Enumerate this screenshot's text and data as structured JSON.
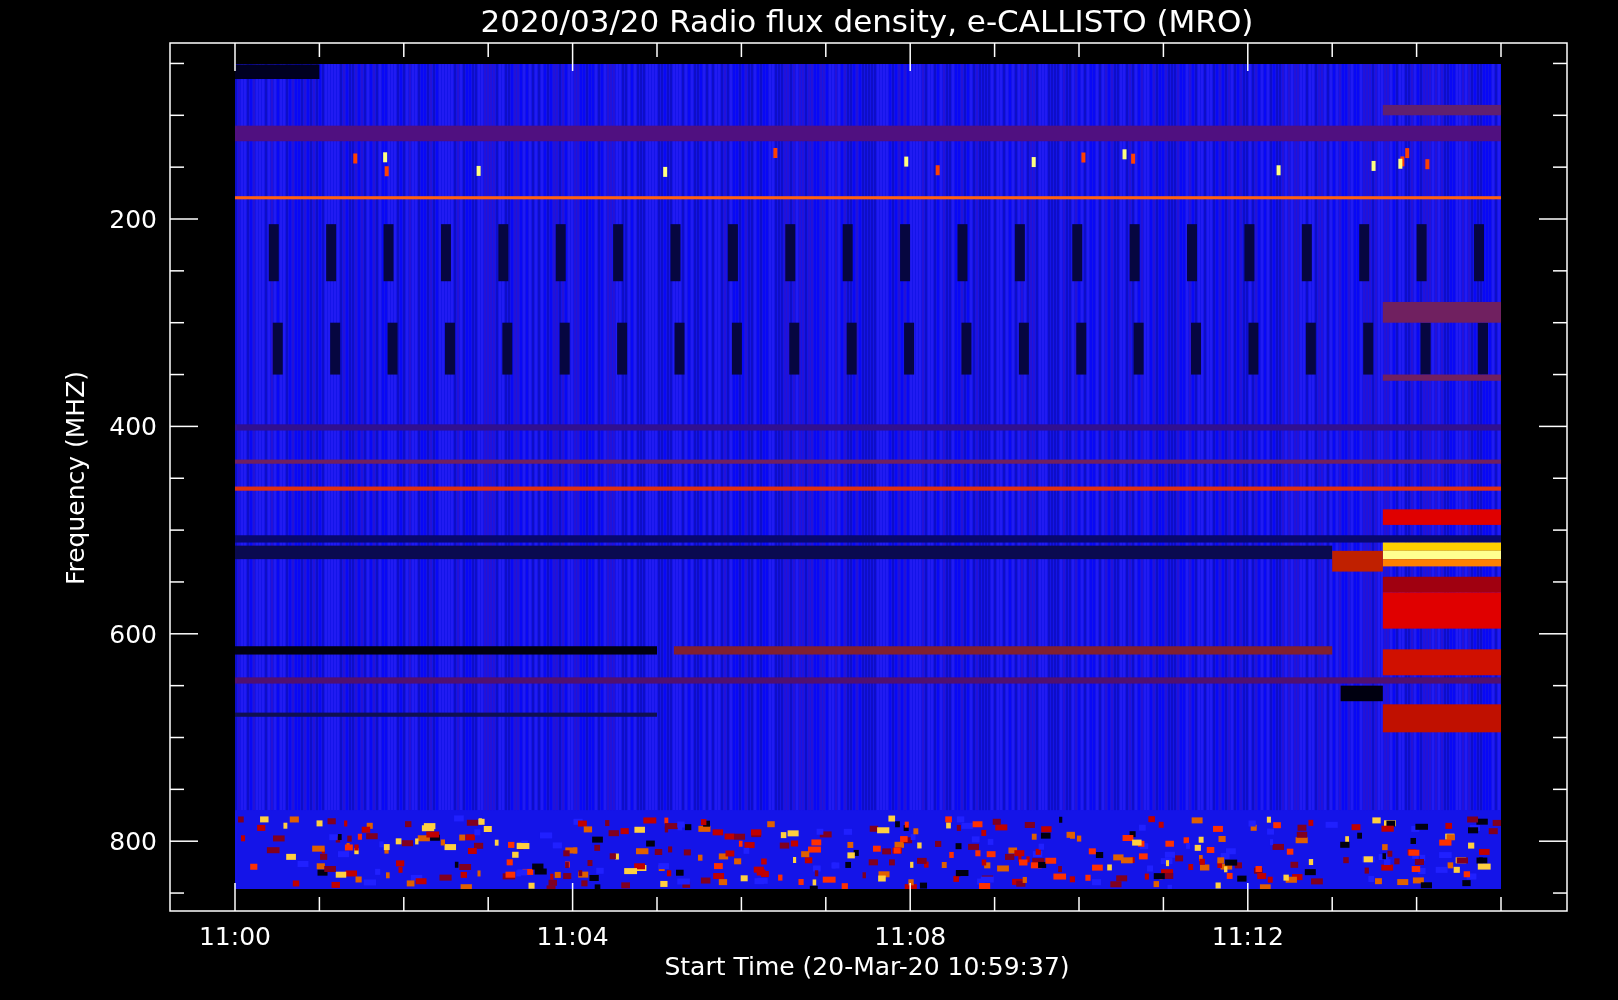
{
  "title": "2020/03/20  Radio flux density, e-CALLISTO (MRO)",
  "y_axis": {
    "label": "Frequency (MHZ)",
    "ticks": [
      "200",
      "400",
      "600",
      "800"
    ]
  },
  "x_axis": {
    "label": "Start Time (20-Mar-20 10:59:37)",
    "ticks": [
      "11:00",
      "11:04",
      "11:08",
      "11:12"
    ]
  }
}
